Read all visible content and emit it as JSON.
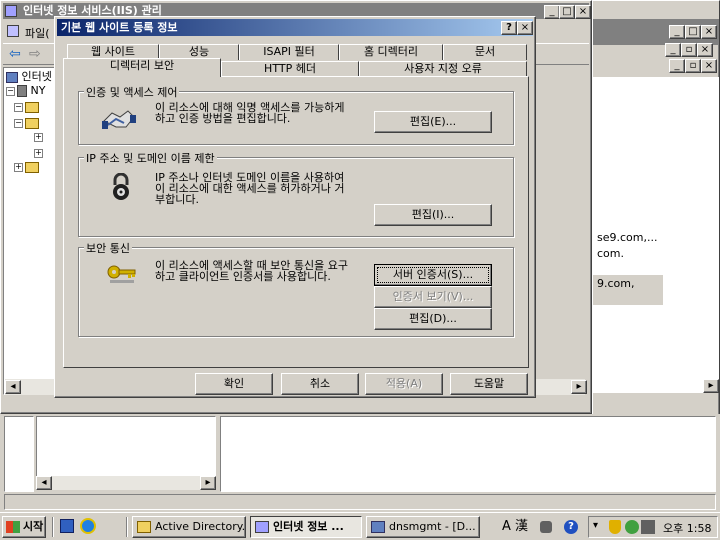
{
  "main_window": {
    "title": "인터넷 정보 서비스(IIS) 관리",
    "menu_file": "파일(",
    "tree_root": "인터넷",
    "tree_node": "NY",
    "right_text1": "se9.com,...",
    "right_text2": "com.",
    "right_text3": "9.com,"
  },
  "dialog": {
    "title": "기본 웹 사이트 등록 정보",
    "tabs_row1": [
      "웹 사이트",
      "성능",
      "ISAPI 필터",
      "홈 디렉터리",
      "문서"
    ],
    "tabs_row2": [
      "디렉터리 보안",
      "HTTP 헤더",
      "사용자 지정 오류"
    ],
    "active_tab": "디렉터리 보안",
    "group_auth": {
      "title": "인증 및 액세스 제어",
      "text": "이 리소스에 대해 익명 액세스를 가능하게\n하고 인증 방법을 편집합니다.",
      "edit_button": "편집(E)..."
    },
    "group_ip": {
      "title": "IP 주소 및 도메인 이름 제한",
      "text": "IP 주소나 인터넷 도메인 이름을 사용하여\n이 리소스에 대한 액세스를 허가하거나 거\n부합니다.",
      "edit_button": "편집(I)..."
    },
    "group_secure": {
      "title": "보안 통신",
      "text": "이 리소스에 액세스할 때 보안 통신을 요구\n하고 클라이언트 인증서를 사용합니다.",
      "server_cert_button": "서버 인증서(S)...",
      "view_cert_button": "인증서 보기(V)...",
      "edit_button": "편집(D)..."
    },
    "footer": {
      "ok": "확인",
      "cancel": "취소",
      "apply": "적용(A)",
      "help": "도움말"
    }
  },
  "taskbar": {
    "start": "시작",
    "items": [
      "Active Directory...",
      "인터넷 정보 ...",
      "dnsmgmt - [D..."
    ],
    "active_index": 1,
    "tray_time": "오후 1:58",
    "ime_label": "A 漢"
  },
  "colors": {
    "face": "#d4d0c8",
    "title_active": "#0a246a",
    "title_inactive": "#808080"
  },
  "icons": [
    "handshake-icon",
    "padlock-icon",
    "key-icon",
    "folder-icon",
    "computer-icon",
    "windows-start-icon"
  ]
}
